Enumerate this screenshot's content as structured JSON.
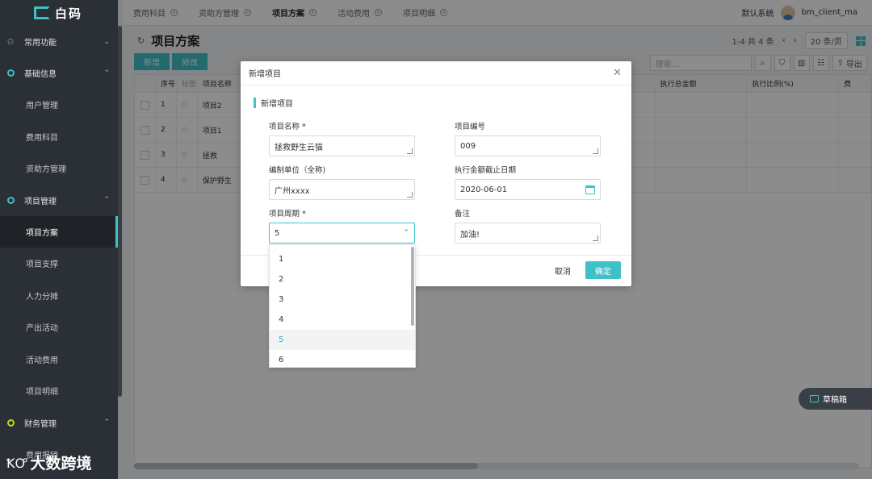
{
  "app": {
    "logo_text": "白码"
  },
  "sidebar": {
    "groups": [
      {
        "label": "常用功能",
        "icon": "star-icon"
      },
      {
        "label": "基础信息",
        "icon": "circle-icon"
      },
      {
        "label": "项目管理",
        "icon": "circle-icon"
      },
      {
        "label": "财务管理",
        "icon": "circle-icon"
      }
    ],
    "basic_items": [
      "用户管理",
      "费用科目",
      "资助方管理"
    ],
    "project_items": [
      "项目方案",
      "项目支撑",
      "人力分摊",
      "产出活动",
      "活动费用",
      "项目明细"
    ],
    "finance_items": [
      "费用报销"
    ]
  },
  "tabs": [
    "费用科目",
    "资助方管理",
    "项目方案",
    "活动费用",
    "项目明细"
  ],
  "topbar": {
    "system": "默认系统",
    "user": "bm_client_ma"
  },
  "page": {
    "title": "项目方案",
    "pager_text": "1-4 共 4 条",
    "page_size": "20 条/页",
    "btn_add": "新增",
    "btn_edit": "修改",
    "search_placeholder": "搜索...",
    "export": "导出"
  },
  "table": {
    "headers": {
      "no": "序号",
      "tag": "标签",
      "name": "项目名称",
      "total": "执行总金额",
      "ratio": "执行比例(%)",
      "more": "费"
    },
    "rows": [
      {
        "no": "1",
        "name": "项目2"
      },
      {
        "no": "2",
        "name": "项目1"
      },
      {
        "no": "3",
        "name": "拯救"
      },
      {
        "no": "4",
        "name": "保护野生"
      }
    ]
  },
  "dialog": {
    "title": "新增项目",
    "section": "新增项目",
    "fields": {
      "name_label": "项目名称 *",
      "name_value": "拯救野生云猫",
      "code_label": "项目编号",
      "code_value": "009",
      "unit_label": "编制单位（全称)",
      "unit_value": "广州xxxx",
      "deadline_label": "执行金额截止日期",
      "deadline_value": "2020-06-01",
      "period_label": "项目周期 *",
      "period_value": "5",
      "note_label": "备注",
      "note_value": "加油!"
    },
    "cancel": "取消",
    "ok": "确定"
  },
  "dropdown": {
    "options": [
      "1",
      "2",
      "3",
      "4",
      "5",
      "6"
    ],
    "selected": "5"
  },
  "draft": {
    "label": "草稿箱"
  },
  "watermark": {
    "text": "大数跨境"
  },
  "colors": {
    "accent": "#3ec1c9",
    "sidebar_bg": "#2b3036"
  }
}
